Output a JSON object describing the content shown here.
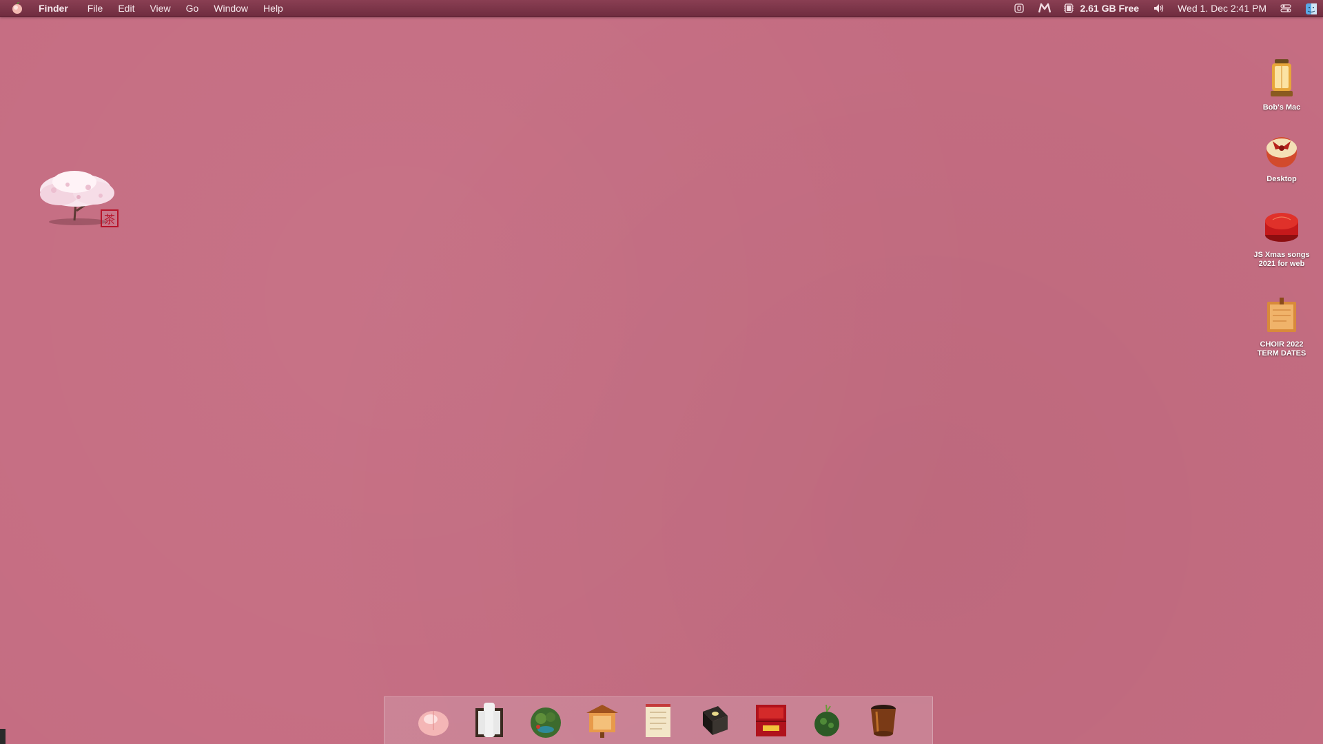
{
  "menubar": {
    "app_name": "Finder",
    "menus": [
      "File",
      "Edit",
      "View",
      "Go",
      "Window",
      "Help"
    ],
    "status": {
      "memory_free": "2.61 GB Free",
      "datetime": "Wed 1. Dec  2:41 PM"
    }
  },
  "widget": {
    "stamp_char": "茶"
  },
  "desktop_icons": [
    {
      "label": "Bob's Mac",
      "icon": "lantern-drive-icon"
    },
    {
      "label": "Desktop",
      "icon": "ribbon-box-icon"
    },
    {
      "label": "JS Xmas songs 2021 for web",
      "icon": "red-lacquer-box-icon"
    },
    {
      "label": "CHOIR 2022 TERM DATES",
      "icon": "document-tag-icon"
    }
  ],
  "dock": {
    "items": [
      {
        "name": "dock-mochi-icon"
      },
      {
        "name": "dock-scroll-book-icon"
      },
      {
        "name": "dock-bonsai-globe-icon"
      },
      {
        "name": "dock-shrine-sign-icon"
      },
      {
        "name": "dock-parchment-icon"
      },
      {
        "name": "dock-black-box-icon"
      },
      {
        "name": "dock-red-chest-icon"
      },
      {
        "name": "dock-moss-ball-icon"
      },
      {
        "name": "dock-wooden-cup-icon"
      }
    ]
  },
  "colors": {
    "desktop": "#c56d82",
    "menubar": "#7a3448"
  }
}
